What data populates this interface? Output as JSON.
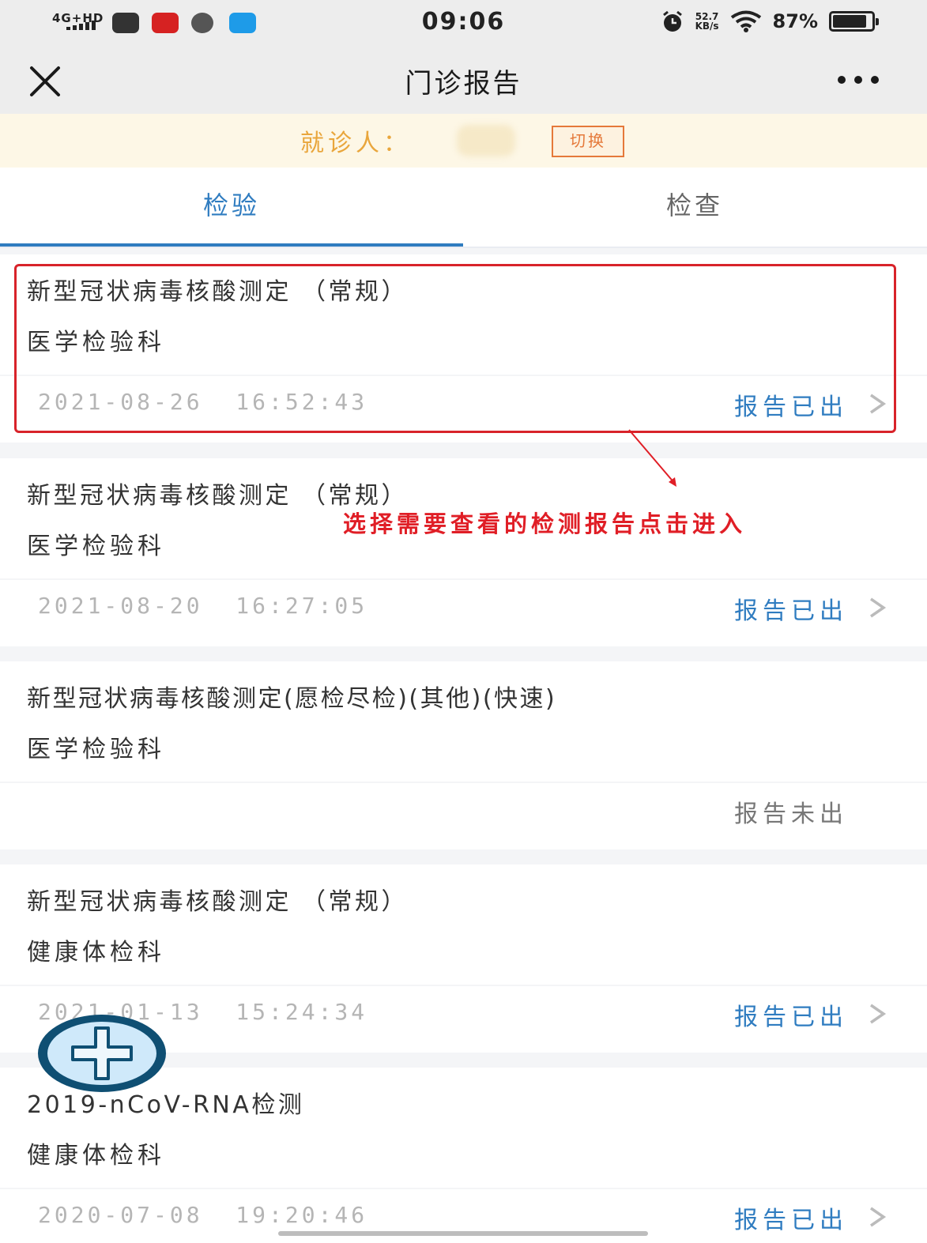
{
  "status_bar": {
    "network": "4G+HD",
    "time": "09:06",
    "speed_value": "52.7",
    "speed_unit": "KB/s",
    "battery": "87%",
    "battery_level": 0.87
  },
  "nav": {
    "title": "门诊报告"
  },
  "patient": {
    "label": "就诊人：",
    "switch_label": "切换"
  },
  "tabs": [
    {
      "label": "检验",
      "active": true
    },
    {
      "label": "检查",
      "active": false
    }
  ],
  "reports": [
    {
      "name": "新型冠状病毒核酸测定 （常规）",
      "dept": "医学检验科",
      "datetime": "2021-08-26  16:52:43",
      "status": "报告已出"
    },
    {
      "name": "新型冠状病毒核酸测定 （常规）",
      "dept": "医学检验科",
      "datetime": "2021-08-20  16:27:05",
      "status": "报告已出"
    },
    {
      "name": "新型冠状病毒核酸测定(愿检尽检)(其他)(快速)",
      "dept": "医学检验科",
      "datetime": "",
      "status": "报告未出"
    },
    {
      "name": "新型冠状病毒核酸测定 （常规）",
      "dept": "健康体检科",
      "datetime": "2021-01-13  15:24:34",
      "status": "报告已出"
    },
    {
      "name": "2019-nCoV-RNA检测",
      "dept": "健康体检科",
      "datetime": "2020-07-08  19:20:46",
      "status": "报告已出"
    }
  ],
  "annotation": {
    "text": "选择需要查看的检测报告点击进入"
  },
  "colors": {
    "accent": "#2f7cc0",
    "patient_label": "#e9a63c",
    "switch": "#e5793a",
    "annotation": "#e01e26"
  }
}
